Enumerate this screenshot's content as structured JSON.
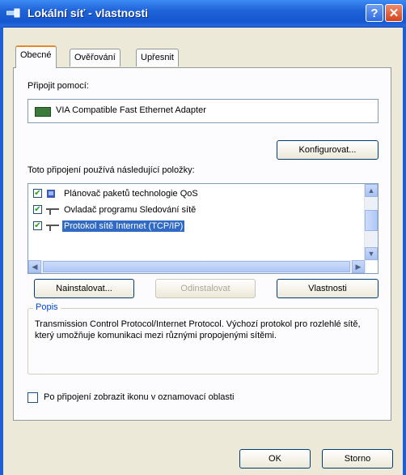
{
  "window": {
    "title": "Lokální síť - vlastnosti",
    "help_label": "?",
    "close_label": "✕"
  },
  "tabs": [
    {
      "label": "Obecné",
      "active": true
    },
    {
      "label": "Ověřování",
      "active": false
    },
    {
      "label": "Upřesnit",
      "active": false
    }
  ],
  "general": {
    "connect_using_label": "Připojit pomocí:",
    "adapter_name": "VIA Compatible Fast Ethernet Adapter",
    "configure_button": "Konfigurovat...",
    "items_label": "Toto připojení používá následující položky:",
    "items": [
      {
        "label": "Plánovač paketů technologie QoS",
        "checked": true,
        "icon": "qos-scheduler-icon",
        "selected": false
      },
      {
        "label": "Ovladač programu Sledování sítě",
        "checked": true,
        "icon": "network-protocol-icon",
        "selected": false
      },
      {
        "label": "Protokol sítě Internet (TCP/IP)",
        "checked": true,
        "icon": "network-protocol-icon",
        "selected": true
      }
    ],
    "install_button": "Nainstalovat...",
    "uninstall_button": "Odinstalovat",
    "properties_button": "Vlastnosti",
    "description_title": "Popis",
    "description_text": "Transmission Control Protocol/Internet Protocol. Výchozí protokol pro rozlehlé sítě, který umožňuje komunikaci mezi různými propojenými sítěmi.",
    "show_icon_label": "Po připojení zobrazit ikonu v oznamovací oblasti",
    "show_icon_checked": false
  },
  "footer": {
    "ok_button": "OK",
    "cancel_button": "Storno"
  },
  "colors": {
    "titlebar": "#1f63d8",
    "selection": "#316ac5",
    "dialog_bg": "#ece9d8"
  }
}
